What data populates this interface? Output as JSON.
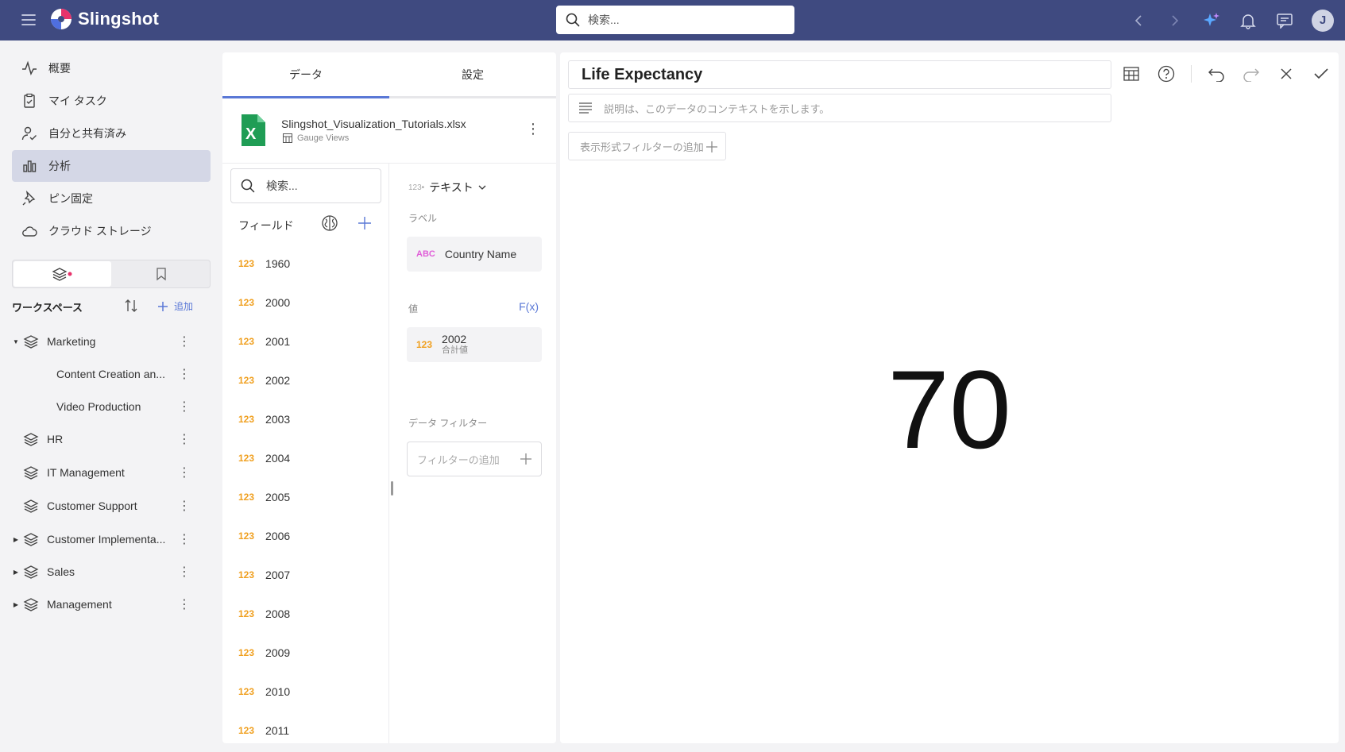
{
  "app": {
    "name": "Slingshot",
    "avatar_initial": "J",
    "search_placeholder": "検索..."
  },
  "nav": {
    "items": [
      {
        "label": "概要",
        "icon": "activity-icon"
      },
      {
        "label": "マイ タスク",
        "icon": "clipboard-check-icon"
      },
      {
        "label": "自分と共有済み",
        "icon": "user-check-icon"
      },
      {
        "label": "分析",
        "icon": "bar-chart-icon"
      },
      {
        "label": "ピン固定",
        "icon": "pin-icon"
      },
      {
        "label": "クラウド ストレージ",
        "icon": "cloud-icon"
      }
    ],
    "active": "分析"
  },
  "workspaces": {
    "title": "ワークスペース",
    "add_label": "追加",
    "items": [
      {
        "label": "Marketing",
        "expanded": true
      },
      {
        "label": "Content Creation an...",
        "child": true
      },
      {
        "label": "Video Production",
        "child": true
      },
      {
        "label": "HR"
      },
      {
        "label": "IT Management"
      },
      {
        "label": "Customer Support"
      },
      {
        "label": "Customer Implementa...",
        "collapsed": true
      },
      {
        "label": "Sales",
        "collapsed": true
      },
      {
        "label": "Management",
        "collapsed": true
      }
    ]
  },
  "editor": {
    "tabs": [
      "データ",
      "設定"
    ],
    "active_tab": "データ",
    "datasource": {
      "file": "Slingshot_Visualization_Tutorials.xlsx",
      "sheet": "Gauge Views"
    },
    "field_search_placeholder": "検索...",
    "fields_title": "フィールド",
    "type_badge": "123",
    "fields": [
      "1960",
      "2000",
      "2001",
      "2002",
      "2003",
      "2004",
      "2005",
      "2006",
      "2007",
      "2008",
      "2009",
      "2010",
      "2011"
    ],
    "viz_type_tag": "123•",
    "viz_type": "テキスト",
    "label_section": "ラベル",
    "label_field": {
      "badge": "ABC",
      "name": "Country Name"
    },
    "value_section": "値",
    "fx_label": "F(x)",
    "value_field": {
      "badge": "123",
      "name": "2002",
      "agg": "合計値"
    },
    "data_filter_section": "データ フィルター",
    "data_filter_placeholder": "フィルターの追加"
  },
  "viz": {
    "title": "Life Expectancy",
    "description_placeholder": "説明は、このデータのコンテキストを示します。",
    "viz_filter_placeholder": "表示形式フィルターの追加",
    "value": "70"
  },
  "colors": {
    "topbar": "#3f4a80",
    "accent": "#5a78d6",
    "number_badge": "#f0a020",
    "text_badge": "#e05fd8"
  }
}
